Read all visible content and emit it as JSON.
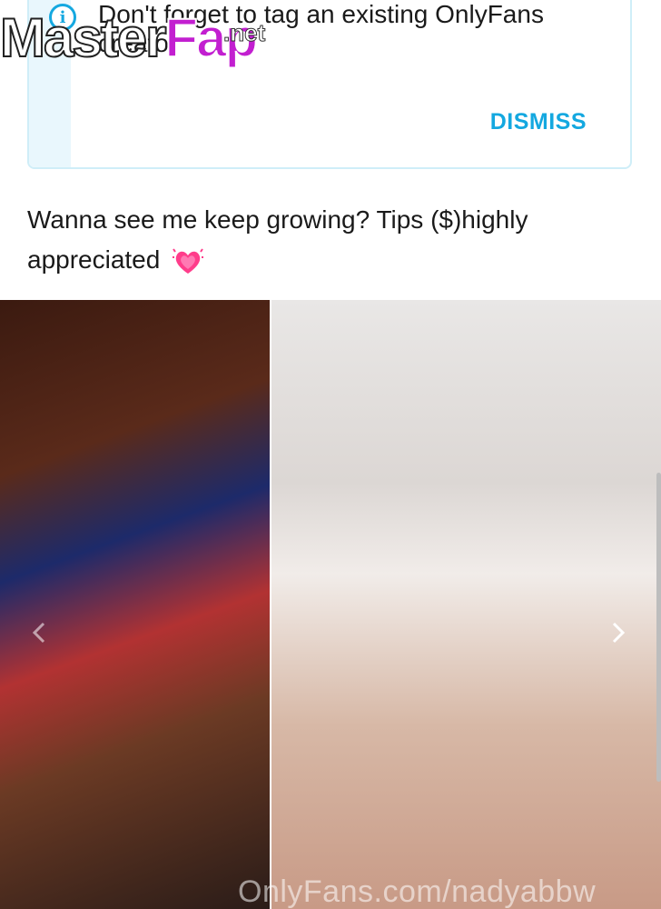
{
  "notice": {
    "text": "Don't forget to tag an existing OnlyFans creator",
    "dismiss_label": "DISMISS",
    "icon": "info-icon",
    "accent_color": "#14a8e0"
  },
  "watermark_logo": {
    "part1": "Master",
    "part2": "Fap",
    "suffix": ".net"
  },
  "post": {
    "caption": "Wanna see me keep growing? Tips ($)highly appreciated",
    "emoji": "growing-heart-emoji"
  },
  "media": {
    "watermark": "OnlyFans.com/nadyabbw",
    "prev_icon": "chevron-left-icon",
    "next_icon": "chevron-right-icon"
  }
}
